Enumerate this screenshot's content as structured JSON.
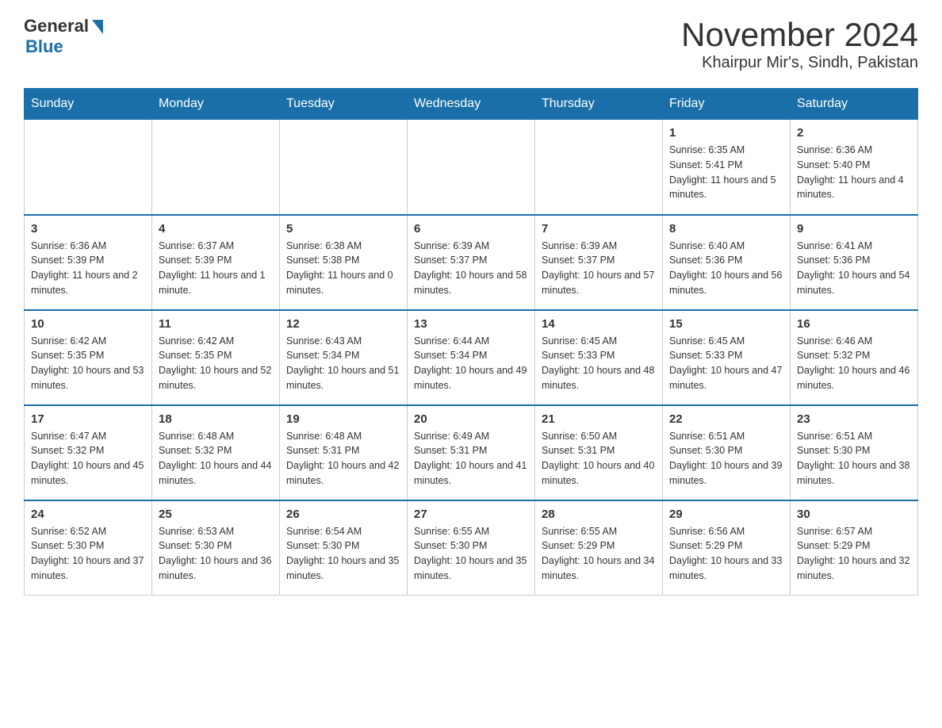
{
  "header": {
    "logo_general": "General",
    "logo_blue": "Blue",
    "title": "November 2024",
    "subtitle": "Khairpur Mir's, Sindh, Pakistan"
  },
  "days_of_week": [
    "Sunday",
    "Monday",
    "Tuesday",
    "Wednesday",
    "Thursday",
    "Friday",
    "Saturday"
  ],
  "weeks": [
    [
      {
        "day": "",
        "info": ""
      },
      {
        "day": "",
        "info": ""
      },
      {
        "day": "",
        "info": ""
      },
      {
        "day": "",
        "info": ""
      },
      {
        "day": "",
        "info": ""
      },
      {
        "day": "1",
        "info": "Sunrise: 6:35 AM\nSunset: 5:41 PM\nDaylight: 11 hours and 5 minutes."
      },
      {
        "day": "2",
        "info": "Sunrise: 6:36 AM\nSunset: 5:40 PM\nDaylight: 11 hours and 4 minutes."
      }
    ],
    [
      {
        "day": "3",
        "info": "Sunrise: 6:36 AM\nSunset: 5:39 PM\nDaylight: 11 hours and 2 minutes."
      },
      {
        "day": "4",
        "info": "Sunrise: 6:37 AM\nSunset: 5:39 PM\nDaylight: 11 hours and 1 minute."
      },
      {
        "day": "5",
        "info": "Sunrise: 6:38 AM\nSunset: 5:38 PM\nDaylight: 11 hours and 0 minutes."
      },
      {
        "day": "6",
        "info": "Sunrise: 6:39 AM\nSunset: 5:37 PM\nDaylight: 10 hours and 58 minutes."
      },
      {
        "day": "7",
        "info": "Sunrise: 6:39 AM\nSunset: 5:37 PM\nDaylight: 10 hours and 57 minutes."
      },
      {
        "day": "8",
        "info": "Sunrise: 6:40 AM\nSunset: 5:36 PM\nDaylight: 10 hours and 56 minutes."
      },
      {
        "day": "9",
        "info": "Sunrise: 6:41 AM\nSunset: 5:36 PM\nDaylight: 10 hours and 54 minutes."
      }
    ],
    [
      {
        "day": "10",
        "info": "Sunrise: 6:42 AM\nSunset: 5:35 PM\nDaylight: 10 hours and 53 minutes."
      },
      {
        "day": "11",
        "info": "Sunrise: 6:42 AM\nSunset: 5:35 PM\nDaylight: 10 hours and 52 minutes."
      },
      {
        "day": "12",
        "info": "Sunrise: 6:43 AM\nSunset: 5:34 PM\nDaylight: 10 hours and 51 minutes."
      },
      {
        "day": "13",
        "info": "Sunrise: 6:44 AM\nSunset: 5:34 PM\nDaylight: 10 hours and 49 minutes."
      },
      {
        "day": "14",
        "info": "Sunrise: 6:45 AM\nSunset: 5:33 PM\nDaylight: 10 hours and 48 minutes."
      },
      {
        "day": "15",
        "info": "Sunrise: 6:45 AM\nSunset: 5:33 PM\nDaylight: 10 hours and 47 minutes."
      },
      {
        "day": "16",
        "info": "Sunrise: 6:46 AM\nSunset: 5:32 PM\nDaylight: 10 hours and 46 minutes."
      }
    ],
    [
      {
        "day": "17",
        "info": "Sunrise: 6:47 AM\nSunset: 5:32 PM\nDaylight: 10 hours and 45 minutes."
      },
      {
        "day": "18",
        "info": "Sunrise: 6:48 AM\nSunset: 5:32 PM\nDaylight: 10 hours and 44 minutes."
      },
      {
        "day": "19",
        "info": "Sunrise: 6:48 AM\nSunset: 5:31 PM\nDaylight: 10 hours and 42 minutes."
      },
      {
        "day": "20",
        "info": "Sunrise: 6:49 AM\nSunset: 5:31 PM\nDaylight: 10 hours and 41 minutes."
      },
      {
        "day": "21",
        "info": "Sunrise: 6:50 AM\nSunset: 5:31 PM\nDaylight: 10 hours and 40 minutes."
      },
      {
        "day": "22",
        "info": "Sunrise: 6:51 AM\nSunset: 5:30 PM\nDaylight: 10 hours and 39 minutes."
      },
      {
        "day": "23",
        "info": "Sunrise: 6:51 AM\nSunset: 5:30 PM\nDaylight: 10 hours and 38 minutes."
      }
    ],
    [
      {
        "day": "24",
        "info": "Sunrise: 6:52 AM\nSunset: 5:30 PM\nDaylight: 10 hours and 37 minutes."
      },
      {
        "day": "25",
        "info": "Sunrise: 6:53 AM\nSunset: 5:30 PM\nDaylight: 10 hours and 36 minutes."
      },
      {
        "day": "26",
        "info": "Sunrise: 6:54 AM\nSunset: 5:30 PM\nDaylight: 10 hours and 35 minutes."
      },
      {
        "day": "27",
        "info": "Sunrise: 6:55 AM\nSunset: 5:30 PM\nDaylight: 10 hours and 35 minutes."
      },
      {
        "day": "28",
        "info": "Sunrise: 6:55 AM\nSunset: 5:29 PM\nDaylight: 10 hours and 34 minutes."
      },
      {
        "day": "29",
        "info": "Sunrise: 6:56 AM\nSunset: 5:29 PM\nDaylight: 10 hours and 33 minutes."
      },
      {
        "day": "30",
        "info": "Sunrise: 6:57 AM\nSunset: 5:29 PM\nDaylight: 10 hours and 32 minutes."
      }
    ]
  ]
}
